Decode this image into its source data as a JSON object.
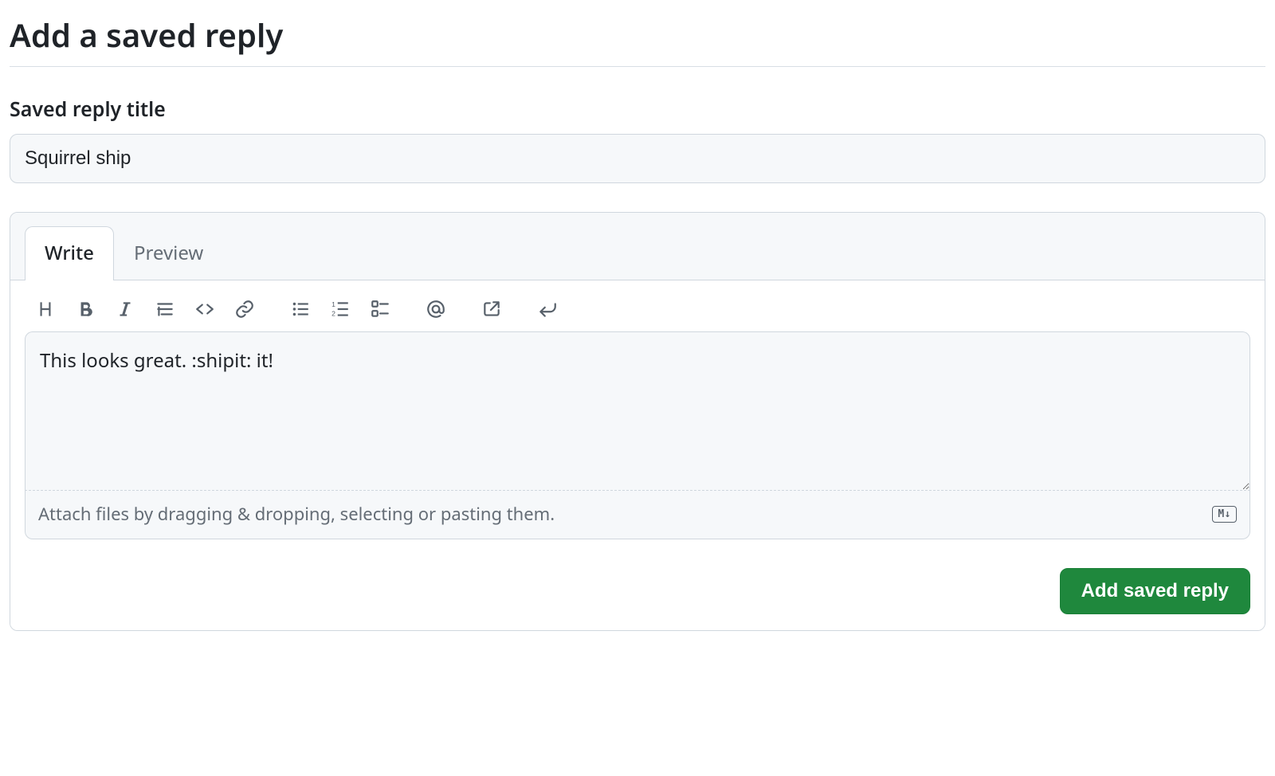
{
  "page": {
    "title": "Add a saved reply"
  },
  "title_field": {
    "label": "Saved reply title",
    "value": "Squirrel ship"
  },
  "editor": {
    "tabs": {
      "write": "Write",
      "preview": "Preview"
    },
    "toolbar_icons": [
      "heading-icon",
      "bold-icon",
      "italic-icon",
      "quote-icon",
      "code-icon",
      "link-icon",
      "unordered-list-icon",
      "ordered-list-icon",
      "task-list-icon",
      "mention-icon",
      "cross-reference-icon",
      "reply-icon"
    ],
    "body_value": "This looks great. :shipit: it!",
    "attach_hint": "Attach files by dragging & dropping, selecting or pasting them.",
    "markdown_badge": "M↓"
  },
  "submit": {
    "label": "Add saved reply"
  }
}
